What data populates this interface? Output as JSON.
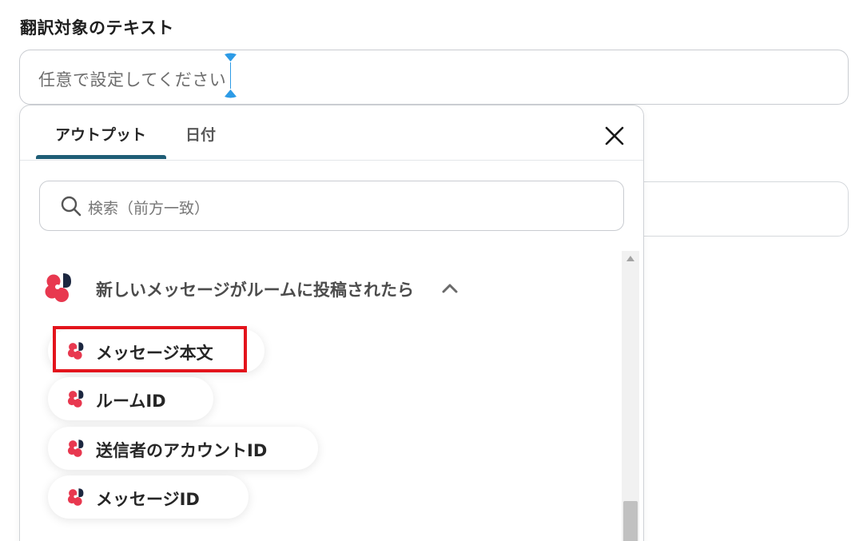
{
  "field": {
    "label": "翻訳対象のテキスト",
    "placeholder": "任意で設定してください"
  },
  "panel": {
    "tabs": [
      {
        "label": "アウトプット",
        "active": true
      },
      {
        "label": "日付",
        "active": false
      }
    ],
    "search_placeholder": "検索（前方一致）",
    "group": {
      "title": "新しいメッセージがルームに投稿されたら",
      "expanded": true
    },
    "items": [
      {
        "label": "メッセージ本文",
        "highlighted": true
      },
      {
        "label": "ルームID",
        "highlighted": false
      },
      {
        "label": "送信者のアカウントID",
        "highlighted": false
      },
      {
        "label": "メッセージID",
        "highlighted": false
      }
    ]
  },
  "colors": {
    "tab_underline": "#1e5d76",
    "highlight": "#e3141c",
    "logo_red": "#e8384f",
    "logo_navy": "#1c2740",
    "caret": "#2d9be6"
  },
  "icons": {
    "close": "close-icon",
    "search": "search-icon",
    "chevron": "chevron-up-icon",
    "app_logo": "chatwork-logo-icon"
  }
}
